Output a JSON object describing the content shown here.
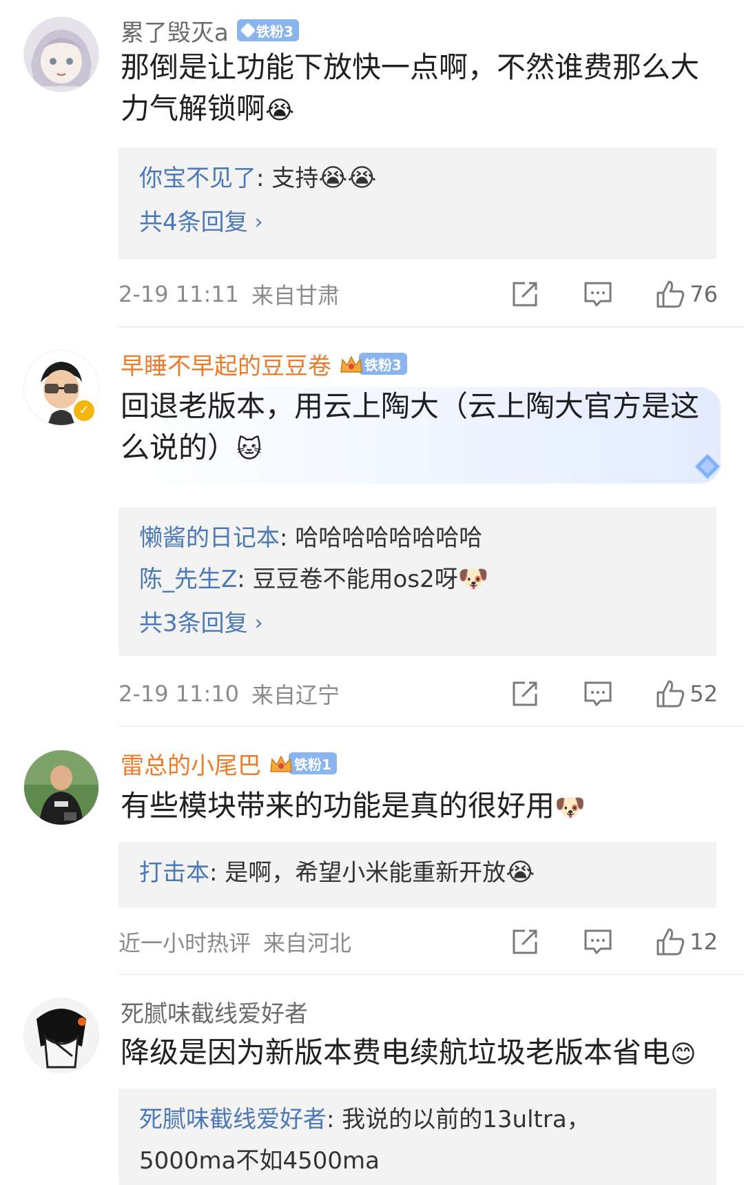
{
  "comments": [
    {
      "username": "累了毁灭a",
      "badge": "铁粉3",
      "text": "那倒是让功能下放快一点啊，不然谁费那么大力气解锁啊",
      "text_emoji": "😭",
      "replies": [
        {
          "author": "你宝不见了",
          "sep": ": ",
          "text": "支持",
          "emoji": "😭😭"
        }
      ],
      "reply_count": "共4条回复",
      "time": "2-19 11:11",
      "location": "来自甘肃",
      "likes": "76"
    },
    {
      "username": "早睡不早起的豆豆卷",
      "badge": "铁粉3",
      "crown_level": "5",
      "text": "回退老版本，用云上陶大（云上陶大官方是这么说的）",
      "text_emoji": "🐱",
      "replies": [
        {
          "author": "懒酱的日记本",
          "sep": ": ",
          "text": "哈哈哈哈哈哈哈哈",
          "emoji": ""
        },
        {
          "author": "陈_先生Z",
          "sep": ": ",
          "text": "豆豆卷不能用os2呀",
          "emoji": "🐶"
        }
      ],
      "reply_count": "共3条回复",
      "time": "2-19 11:10",
      "location": "来自辽宁",
      "likes": "52"
    },
    {
      "username": "雷总的小尾巴",
      "badge": "铁粉1",
      "crown_level": "6",
      "text": "有些模块带来的功能是真的很好用",
      "text_emoji": "🐶",
      "replies": [
        {
          "author": "打击本",
          "sep": ": ",
          "text": "是啊，希望小米能重新开放",
          "emoji": "😭"
        }
      ],
      "time": "近一小时热评",
      "location": "来自河北",
      "likes": "12"
    },
    {
      "username": "死腻味截线爱好者",
      "text": "降级是因为新版本费电续航垃圾老版本省电",
      "text_emoji": "😊",
      "replies": [
        {
          "author": "死腻味截线爱好者",
          "sep": ": ",
          "text": "我说的以前的13ultra，",
          "text2": "5000ma不如4500ma"
        }
      ]
    }
  ],
  "icons": {
    "share": "share-icon",
    "comment": "comment-icon",
    "like": "thumbs-up-icon",
    "verified": "verified-icon"
  },
  "colors": {
    "username_orange": "#ec7a27",
    "reply_blue": "#4b79b7",
    "badge_blue": "#8ab4ee",
    "meta_gray": "#8a8a8a"
  }
}
